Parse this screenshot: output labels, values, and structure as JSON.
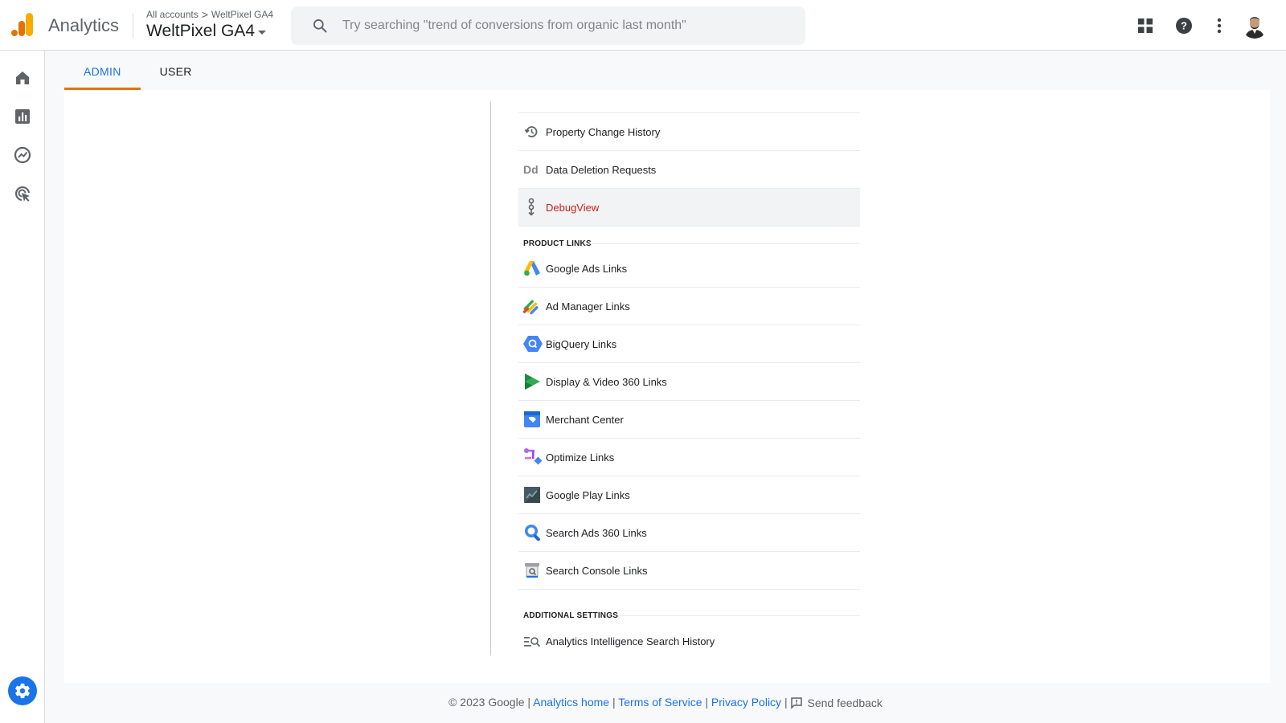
{
  "header": {
    "brand": "Analytics",
    "breadcrumb": {
      "root": "All accounts",
      "separator": ">",
      "account": "WeltPixel GA4"
    },
    "property": "WeltPixel GA4",
    "search_placeholder": "Try searching \"trend of conversions from organic last month\""
  },
  "tabs": [
    {
      "label": "ADMIN",
      "active": true
    },
    {
      "label": "USER",
      "active": false
    }
  ],
  "menu": {
    "items_top": [
      {
        "label": "Property Change History",
        "icon": "history-icon"
      },
      {
        "label": "Data Deletion Requests",
        "icon": "data-deletion-icon",
        "icon_text": "Dd"
      },
      {
        "label": "DebugView",
        "icon": "debug-icon",
        "selected": true
      }
    ],
    "product_links_heading": "PRODUCT LINKS",
    "product_links": [
      {
        "label": "Google Ads Links",
        "icon": "google-ads-icon"
      },
      {
        "label": "Ad Manager Links",
        "icon": "ad-manager-icon"
      },
      {
        "label": "BigQuery Links",
        "icon": "bigquery-icon"
      },
      {
        "label": "Display & Video 360 Links",
        "icon": "display-video-360-icon"
      },
      {
        "label": "Merchant Center",
        "icon": "merchant-center-icon"
      },
      {
        "label": "Optimize Links",
        "icon": "optimize-icon"
      },
      {
        "label": "Google Play Links",
        "icon": "google-play-icon"
      },
      {
        "label": "Search Ads 360 Links",
        "icon": "search-ads-360-icon"
      },
      {
        "label": "Search Console Links",
        "icon": "search-console-icon"
      }
    ],
    "additional_heading": "ADDITIONAL SETTINGS",
    "additional": [
      {
        "label": "Analytics Intelligence Search History",
        "icon": "search-history-icon"
      }
    ]
  },
  "footer": {
    "copyright": "© 2023 Google",
    "sep": "|",
    "analytics_home": "Analytics home",
    "terms": "Terms of Service",
    "privacy": "Privacy Policy",
    "feedback": "Send feedback"
  },
  "colors": {
    "accent": "#1a73e8",
    "tab_indicator": "#e8710a",
    "selected_text": "#c5221f"
  }
}
